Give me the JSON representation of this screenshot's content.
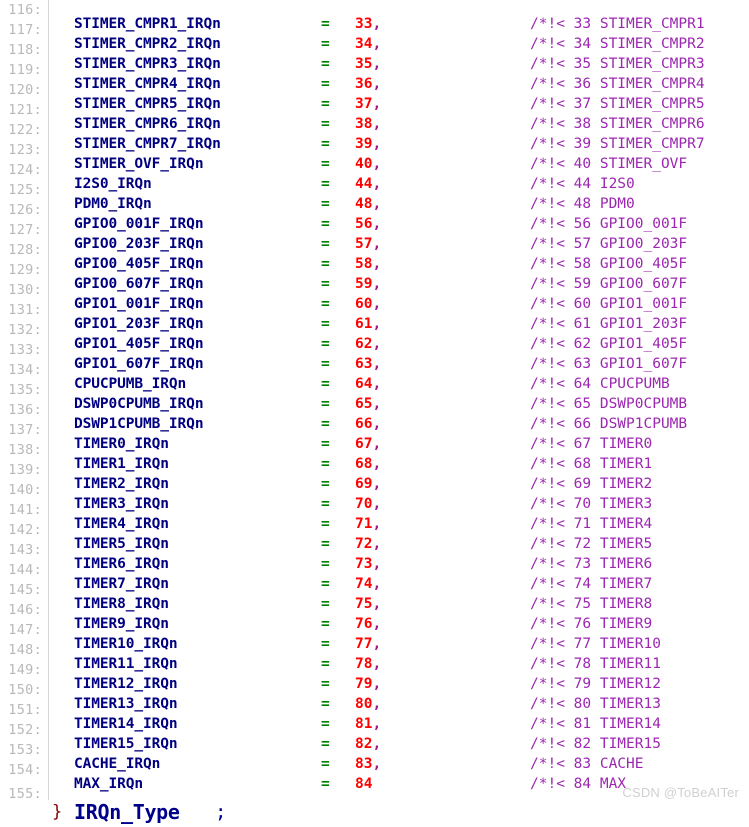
{
  "editor": {
    "language": "c",
    "watermark": "CSDN @ToBeAITer",
    "colors": {
      "background": "#ffffff",
      "line_number": "#b9b9b9",
      "gutter_rule": "#d7d7d7",
      "identifier": "#000080",
      "operator_equals": "#008000",
      "number": "#ff0000",
      "comma": "#a31585",
      "comment": "#9c27b0",
      "brace": "#800000",
      "type_name": "#00008b",
      "watermark": "#d0d0d0"
    }
  },
  "lines": [
    {
      "no": "116:",
      "ident": "STIMER_CMPR1_IRQn",
      "eq": "=",
      "value": "33",
      "comma": ",",
      "comment": "/*!< 33 STIMER_CMPR1"
    },
    {
      "no": "117:",
      "ident": "STIMER_CMPR2_IRQn",
      "eq": "=",
      "value": "34",
      "comma": ",",
      "comment": "/*!< 34 STIMER_CMPR2"
    },
    {
      "no": "118:",
      "ident": "STIMER_CMPR3_IRQn",
      "eq": "=",
      "value": "35",
      "comma": ",",
      "comment": "/*!< 35 STIMER_CMPR3"
    },
    {
      "no": "119:",
      "ident": "STIMER_CMPR4_IRQn",
      "eq": "=",
      "value": "36",
      "comma": ",",
      "comment": "/*!< 36 STIMER_CMPR4"
    },
    {
      "no": "120:",
      "ident": "STIMER_CMPR5_IRQn",
      "eq": "=",
      "value": "37",
      "comma": ",",
      "comment": "/*!< 37 STIMER_CMPR5"
    },
    {
      "no": "121:",
      "ident": "STIMER_CMPR6_IRQn",
      "eq": "=",
      "value": "38",
      "comma": ",",
      "comment": "/*!< 38 STIMER_CMPR6"
    },
    {
      "no": "122:",
      "ident": "STIMER_CMPR7_IRQn",
      "eq": "=",
      "value": "39",
      "comma": ",",
      "comment": "/*!< 39 STIMER_CMPR7"
    },
    {
      "no": "123:",
      "ident": "STIMER_OVF_IRQn",
      "eq": "=",
      "value": "40",
      "comma": ",",
      "comment": "/*!< 40 STIMER_OVF"
    },
    {
      "no": "124:",
      "ident": "I2S0_IRQn",
      "eq": "=",
      "value": "44",
      "comma": ",",
      "comment": "/*!< 44 I2S0"
    },
    {
      "no": "125:",
      "ident": "PDM0_IRQn",
      "eq": "=",
      "value": "48",
      "comma": ",",
      "comment": "/*!< 48 PDM0"
    },
    {
      "no": "126:",
      "ident": "GPIO0_001F_IRQn",
      "eq": "=",
      "value": "56",
      "comma": ",",
      "comment": "/*!< 56 GPIO0_001F"
    },
    {
      "no": "127:",
      "ident": "GPIO0_203F_IRQn",
      "eq": "=",
      "value": "57",
      "comma": ",",
      "comment": "/*!< 57 GPIO0_203F"
    },
    {
      "no": "128:",
      "ident": "GPIO0_405F_IRQn",
      "eq": "=",
      "value": "58",
      "comma": ",",
      "comment": "/*!< 58 GPIO0_405F"
    },
    {
      "no": "129:",
      "ident": "GPIO0_607F_IRQn",
      "eq": "=",
      "value": "59",
      "comma": ",",
      "comment": "/*!< 59 GPIO0_607F"
    },
    {
      "no": "130:",
      "ident": "GPIO1_001F_IRQn",
      "eq": "=",
      "value": "60",
      "comma": ",",
      "comment": "/*!< 60 GPIO1_001F"
    },
    {
      "no": "131:",
      "ident": "GPIO1_203F_IRQn",
      "eq": "=",
      "value": "61",
      "comma": ",",
      "comment": "/*!< 61 GPIO1_203F"
    },
    {
      "no": "132:",
      "ident": "GPIO1_405F_IRQn",
      "eq": "=",
      "value": "62",
      "comma": ",",
      "comment": "/*!< 62 GPIO1_405F"
    },
    {
      "no": "133:",
      "ident": "GPIO1_607F_IRQn",
      "eq": "=",
      "value": "63",
      "comma": ",",
      "comment": "/*!< 63 GPIO1_607F"
    },
    {
      "no": "134:",
      "ident": "CPUCPUMB_IRQn",
      "eq": "=",
      "value": "64",
      "comma": ",",
      "comment": "/*!< 64 CPUCPUMB"
    },
    {
      "no": "135:",
      "ident": "DSWP0CPUMB_IRQn",
      "eq": "=",
      "value": "65",
      "comma": ",",
      "comment": "/*!< 65 DSWP0CPUMB"
    },
    {
      "no": "136:",
      "ident": "DSWP1CPUMB_IRQn",
      "eq": "=",
      "value": "66",
      "comma": ",",
      "comment": "/*!< 66 DSWP1CPUMB"
    },
    {
      "no": "137:",
      "ident": "TIMER0_IRQn",
      "eq": "=",
      "value": "67",
      "comma": ",",
      "comment": "/*!< 67 TIMER0"
    },
    {
      "no": "138:",
      "ident": "TIMER1_IRQn",
      "eq": "=",
      "value": "68",
      "comma": ",",
      "comment": "/*!< 68 TIMER1"
    },
    {
      "no": "139:",
      "ident": "TIMER2_IRQn",
      "eq": "=",
      "value": "69",
      "comma": ",",
      "comment": "/*!< 69 TIMER2"
    },
    {
      "no": "140:",
      "ident": "TIMER3_IRQn",
      "eq": "=",
      "value": "70",
      "comma": ",",
      "comment": "/*!< 70 TIMER3"
    },
    {
      "no": "141:",
      "ident": "TIMER4_IRQn",
      "eq": "=",
      "value": "71",
      "comma": ",",
      "comment": "/*!< 71 TIMER4"
    },
    {
      "no": "142:",
      "ident": "TIMER5_IRQn",
      "eq": "=",
      "value": "72",
      "comma": ",",
      "comment": "/*!< 72 TIMER5"
    },
    {
      "no": "143:",
      "ident": "TIMER6_IRQn",
      "eq": "=",
      "value": "73",
      "comma": ",",
      "comment": "/*!< 73 TIMER6"
    },
    {
      "no": "144:",
      "ident": "TIMER7_IRQn",
      "eq": "=",
      "value": "74",
      "comma": ",",
      "comment": "/*!< 74 TIMER7"
    },
    {
      "no": "145:",
      "ident": "TIMER8_IRQn",
      "eq": "=",
      "value": "75",
      "comma": ",",
      "comment": "/*!< 75 TIMER8"
    },
    {
      "no": "146:",
      "ident": "TIMER9_IRQn",
      "eq": "=",
      "value": "76",
      "comma": ",",
      "comment": "/*!< 76 TIMER9"
    },
    {
      "no": "147:",
      "ident": "TIMER10_IRQn",
      "eq": "=",
      "value": "77",
      "comma": ",",
      "comment": "/*!< 77 TIMER10"
    },
    {
      "no": "148:",
      "ident": "TIMER11_IRQn",
      "eq": "=",
      "value": "78",
      "comma": ",",
      "comment": "/*!< 78 TIMER11"
    },
    {
      "no": "149:",
      "ident": "TIMER12_IRQn",
      "eq": "=",
      "value": "79",
      "comma": ",",
      "comment": "/*!< 79 TIMER12"
    },
    {
      "no": "150:",
      "ident": "TIMER13_IRQn",
      "eq": "=",
      "value": "80",
      "comma": ",",
      "comment": "/*!< 80 TIMER13"
    },
    {
      "no": "151:",
      "ident": "TIMER14_IRQn",
      "eq": "=",
      "value": "81",
      "comma": ",",
      "comment": "/*!< 81 TIMER14"
    },
    {
      "no": "152:",
      "ident": "TIMER15_IRQn",
      "eq": "=",
      "value": "82",
      "comma": ",",
      "comment": "/*!< 82 TIMER15"
    },
    {
      "no": "153:",
      "ident": "CACHE_IRQn",
      "eq": "=",
      "value": "83",
      "comma": ",",
      "comment": "/*!< 83 CACHE"
    },
    {
      "no": "154:",
      "ident": "MAX_IRQn",
      "eq": "=",
      "value": "84",
      "comma": "",
      "comment": "/*!< 84 MAX"
    }
  ],
  "closing_line": {
    "no": "155:",
    "brace": "}",
    "type_name": "IRQn_Type",
    "semicolon": ";"
  }
}
